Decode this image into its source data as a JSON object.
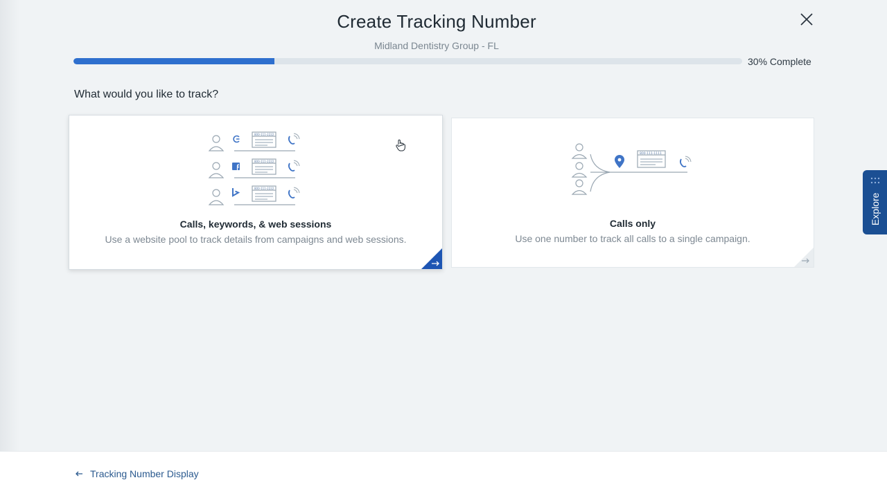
{
  "header": {
    "title": "Create Tracking Number",
    "subtitle": "Midland Dentistry Group - FL",
    "close_icon": "close-icon"
  },
  "progress": {
    "percent": 30,
    "label": "30% Complete",
    "fill_color": "#2e6fce"
  },
  "question": "What would you like to track?",
  "options": [
    {
      "title": "Calls, keywords, & web sessions",
      "description": "Use a website pool to track details from campaigns and web sessions.",
      "selected": true,
      "sources": [
        "google-icon",
        "facebook-icon",
        "bing-icon"
      ],
      "number_text": "800-111-2222"
    },
    {
      "title": "Calls only",
      "description": "Use one number to track all calls to a single campaign.",
      "selected": false,
      "number_text": "800-111-1111"
    }
  ],
  "explore": {
    "label": "Explore"
  },
  "footer": {
    "back_label": "Tracking Number Display",
    "back_icon": "arrow-left-icon"
  },
  "colors": {
    "accent": "#2e6fce",
    "explore_bg": "#1b4f93",
    "link": "#2b5a8f"
  }
}
